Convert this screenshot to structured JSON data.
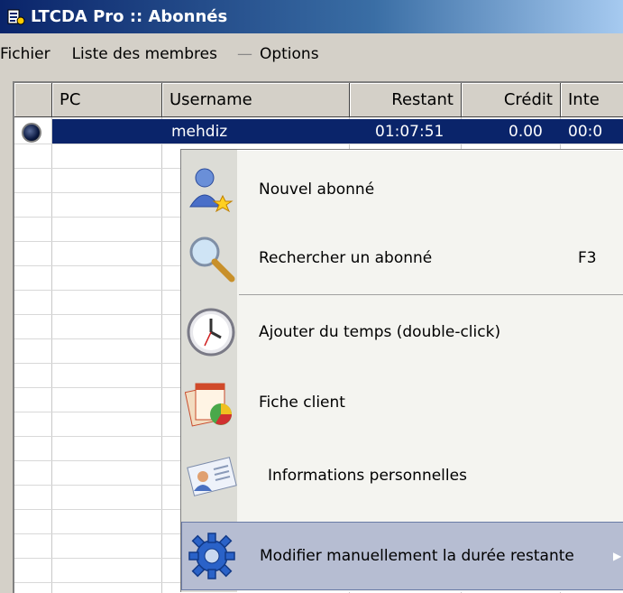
{
  "window": {
    "title": "LTCDA Pro :: Abonnés"
  },
  "menubar": {
    "items": [
      "Fichier",
      "Liste des membres",
      "Options"
    ]
  },
  "table": {
    "columns": [
      "PC",
      "Username",
      "Restant",
      "Crédit",
      "Inte"
    ],
    "rows": [
      {
        "pc": "",
        "username": "mehdiz",
        "restant": "01:07:51",
        "credit": "0.00",
        "inte": "00:0"
      }
    ]
  },
  "context_menu": {
    "items": [
      {
        "label": "Nouvel abonné",
        "shortcut": "",
        "icon": "new-user-icon"
      },
      {
        "label": "Rechercher un abonné",
        "shortcut": "F3",
        "icon": "magnifier-icon"
      },
      {
        "label": "Ajouter du temps (double-click)",
        "shortcut": "",
        "icon": "clock-icon"
      },
      {
        "label": "Fiche client",
        "shortcut": "",
        "icon": "client-card-icon"
      },
      {
        "label": "Informations personnelles",
        "shortcut": "",
        "icon": "id-card-icon"
      },
      {
        "label": "Modifier manuellement la durée restante",
        "shortcut": "",
        "icon": "gear-icon",
        "submenu": true
      }
    ]
  },
  "colors": {
    "title_start": "#0a246a",
    "selection": "#0a246a",
    "menu_highlight": "#b6bdd2"
  }
}
